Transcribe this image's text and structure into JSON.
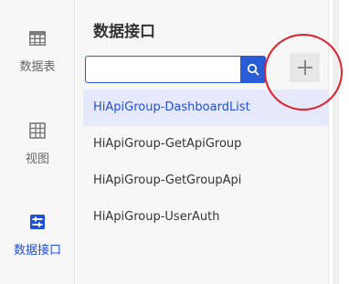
{
  "nav": {
    "items": [
      {
        "label": "数据表",
        "icon": "table-grid-icon"
      },
      {
        "label": "视图",
        "icon": "view-grid-icon"
      },
      {
        "label": "数据接口",
        "icon": "api-interface-icon",
        "active": true
      }
    ]
  },
  "panel": {
    "title": "数据接口",
    "search": {
      "value": "",
      "placeholder": ""
    },
    "search_icon": "search-icon",
    "add_icon": "plus-icon",
    "items": [
      {
        "label": "HiApiGroup-DashboardList",
        "selected": true
      },
      {
        "label": "HiApiGroup-GetApiGroup"
      },
      {
        "label": "HiApiGroup-GetGroupApi"
      },
      {
        "label": "HiApiGroup-UserAuth"
      }
    ]
  },
  "colors": {
    "accent": "#2a5bd7",
    "active_text": "#1f4ee0",
    "selected_bg": "#e6e9fb",
    "annotation": "#e2202c"
  }
}
